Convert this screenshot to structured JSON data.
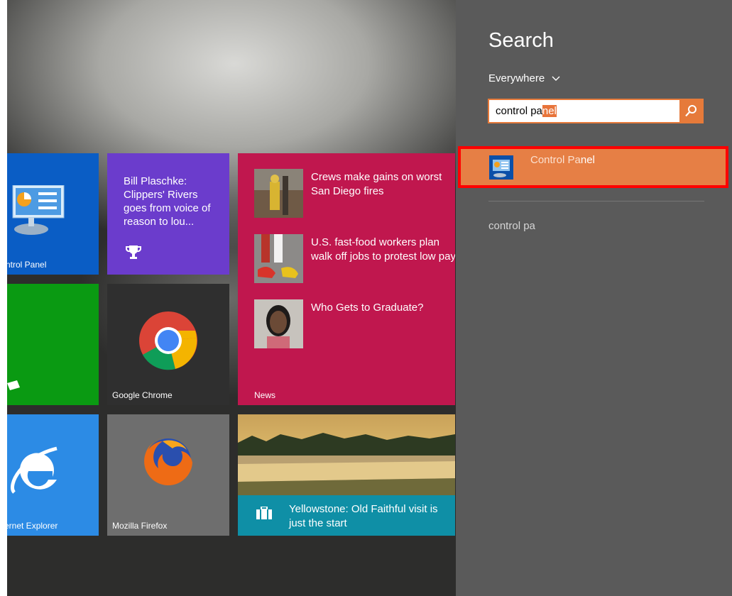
{
  "tiles": {
    "control_panel": {
      "label": "ntrol Panel",
      "color": "#0a5dc5"
    },
    "sports": {
      "text": "Bill Plaschke: Clippers' Rivers goes from voice of reason to lou...",
      "icon": "trophy-icon"
    },
    "chrome": {
      "label": "Google Chrome"
    },
    "news": {
      "label": "News",
      "items": [
        {
          "headline": "Crews make gains on worst San Diego fires"
        },
        {
          "headline": "U.S. fast-food workers plan walk off jobs to protest low pay"
        },
        {
          "headline": "Who Gets to Graduate?"
        }
      ]
    },
    "ie": {
      "label": "ernet Explorer"
    },
    "firefox": {
      "label": "Mozilla Firefox"
    },
    "travel": {
      "text": "Yellowstone: Old Faithful visit is just the start",
      "icon": "suitcase-icon"
    }
  },
  "search": {
    "title": "Search",
    "scope": "Everywhere",
    "query_typed": "control pa",
    "query_autocomplete": "nel",
    "button_icon": "search-icon",
    "results": [
      {
        "label_match": "Control Pa",
        "label_rest": "nel",
        "icon": "control-panel-icon"
      }
    ],
    "suggestions": [
      "control pa"
    ]
  },
  "colors": {
    "accent": "#e67a3a",
    "charm_bg": "#5a5a5a",
    "highlight_border": "#ff0000"
  }
}
